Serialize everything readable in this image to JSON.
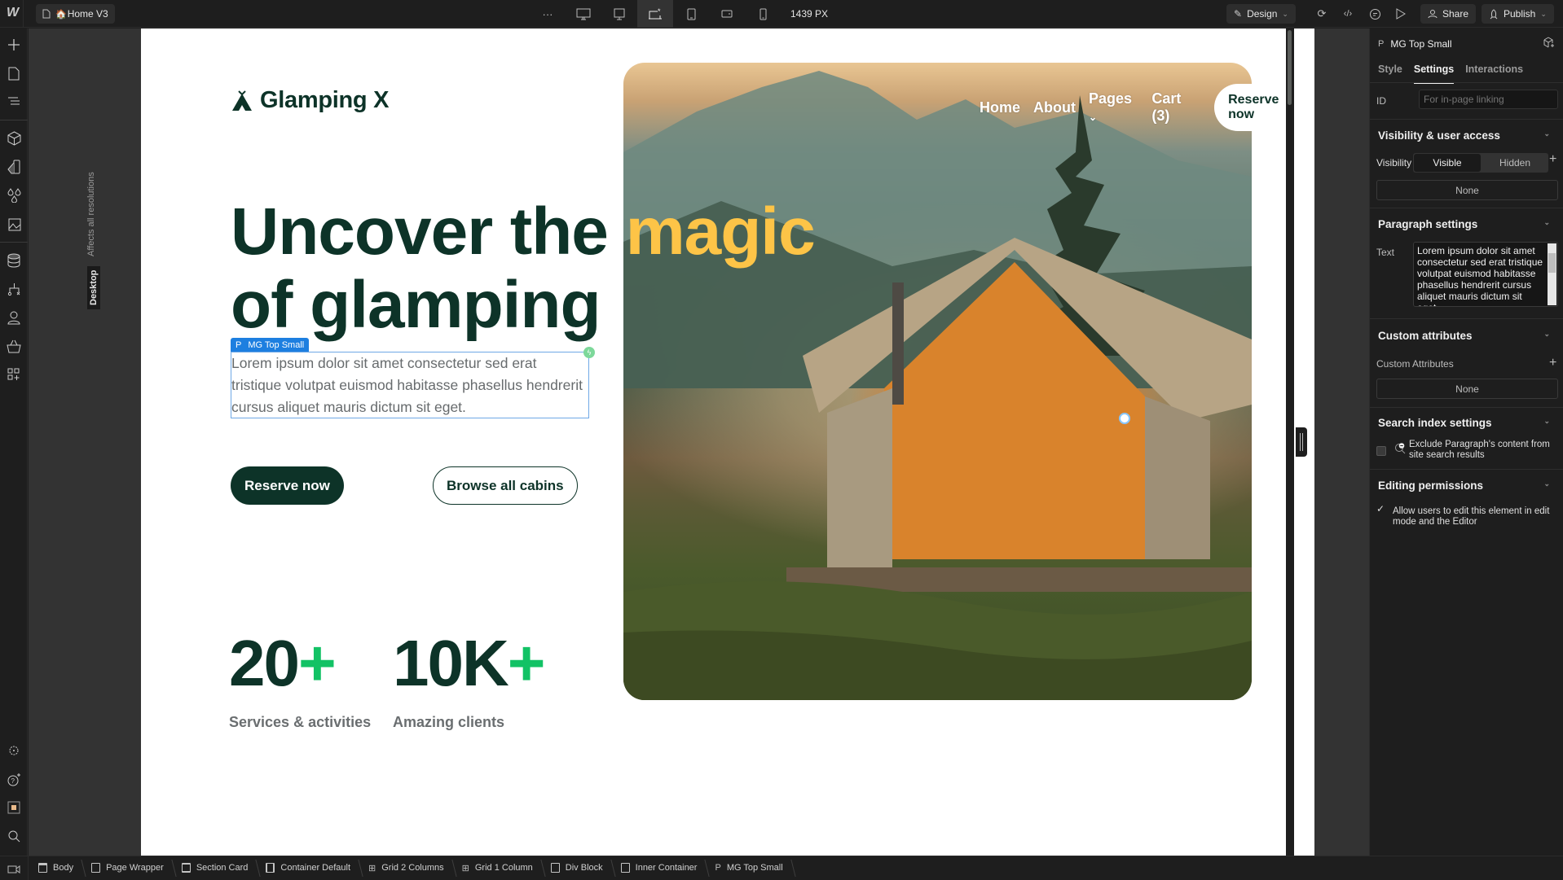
{
  "topbar": {
    "page_name": "Home V3",
    "more_label": "···",
    "breakpoint_readout": "1439 PX",
    "design_label": "Design",
    "share_label": "Share",
    "publish_label": "Publish"
  },
  "canvas": {
    "affects_label": "Affects all resolutions",
    "breakpoint_label": "Desktop"
  },
  "site": {
    "logo_text": "Glamping X",
    "nav": [
      "Home",
      "About",
      "Pages",
      "Cart (3)"
    ],
    "nav_cta": "Reserve now",
    "headline_part1": "Uncover the ",
    "headline_accent": "magic",
    "headline_part2": "of glamping",
    "selected_tag_prefix": "P",
    "selected_tag_label": "MG Top Small",
    "paragraph": "Lorem ipsum dolor sit amet consectetur sed erat tristique volutpat euismod habitasse phasellus hendrerit cursus aliquet mauris dictum sit eget.",
    "primary_button": "Reserve now",
    "secondary_button": "Browse all cabins",
    "stats": [
      {
        "value": "20",
        "suffix": "+",
        "label": "Services & activities"
      },
      {
        "value": "10K",
        "suffix": "+",
        "label": "Amazing clients"
      }
    ],
    "colors": {
      "brand_dark": "#0d3328",
      "accent_yellow": "#fdc447",
      "accent_green": "#12c265",
      "selection_blue": "#1d7fe0"
    }
  },
  "panel": {
    "element_type": "P",
    "element_name": "MG Top Small",
    "tabs": [
      "Style",
      "Settings",
      "Interactions"
    ],
    "active_tab": "Settings",
    "id_label": "ID",
    "id_placeholder": "For in-page linking",
    "visibility_section": "Visibility & user access",
    "visibility_label": "Visibility",
    "visibility_options": [
      "Visible",
      "Hidden"
    ],
    "visibility_selected": "Visible",
    "visibility_conditions": "None",
    "paragraph_section": "Paragraph settings",
    "text_label": "Text",
    "text_value": "Lorem ipsum dolor sit amet consectetur sed erat tristique volutpat euismod habitasse phasellus hendrerit cursus aliquet mauris dictum sit eget.",
    "custom_attr_section": "Custom attributes",
    "custom_attr_label": "Custom Attributes",
    "custom_attr_value": "None",
    "search_section": "Search index settings",
    "search_exclude_label": "Exclude Paragraph's content from site search results",
    "search_exclude_checked": false,
    "editing_section": "Editing permissions",
    "editing_label": "Allow users to edit this element in edit mode and the Editor",
    "editing_checked": true
  },
  "breadcrumbs": [
    {
      "icon": "body-icon",
      "label": "Body"
    },
    {
      "icon": "box-icon",
      "label": "Page Wrapper"
    },
    {
      "icon": "section-icon",
      "label": "Section Card"
    },
    {
      "icon": "container-icon",
      "label": "Container Default"
    },
    {
      "icon": "grid-icon",
      "label": "Grid 2 Columns"
    },
    {
      "icon": "grid-icon",
      "label": "Grid 1 Column"
    },
    {
      "icon": "box-icon",
      "label": "Div Block"
    },
    {
      "icon": "box-icon",
      "label": "Inner Container"
    },
    {
      "icon": "paragraph-icon",
      "label": "MG Top Small"
    }
  ]
}
